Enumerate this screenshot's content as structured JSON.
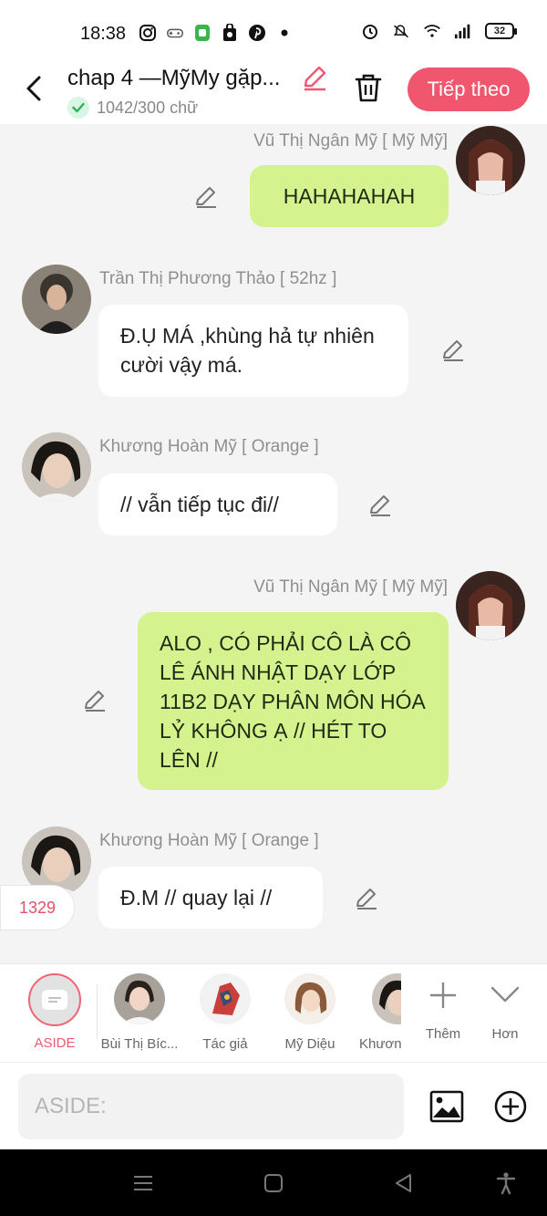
{
  "status": {
    "time": "18:38",
    "battery": "32"
  },
  "header": {
    "title": "chap 4 —MỹMy gặp...",
    "word_count": "1042/300 chữ",
    "next_label": "Tiếp theo"
  },
  "messages": [
    {
      "name": "Vũ Thị Ngân Mỹ [ Mỹ Mỹ]",
      "text": "HAHAHAHAH"
    },
    {
      "name": "Trần Thị Phương Thảo [ 52hz ]",
      "text": "Đ.Ụ MÁ ,khùng hả tự nhiên cười vậy má."
    },
    {
      "name": "Khương Hoàn Mỹ [ Orange ]",
      "text": "// vẫn tiếp tục đi//"
    },
    {
      "name": "Vũ Thị Ngân Mỹ [ Mỹ Mỹ]",
      "text": "ALO , CÓ PHẢI CÔ LÀ CÔ LÊ ÁNH NHẬT DẠY LỚP 11B2 DẠY PHÂN MÔN HÓA LỶ KHÔNG Ạ // HÉT TO LÊN //"
    },
    {
      "name": "Khương Hoàn Mỹ [ Orange ]",
      "text": "Đ.M // quay lại //"
    }
  ],
  "counter": "1329",
  "characters": [
    {
      "label": "ASIDE"
    },
    {
      "label": "Bùi Thị Bíc..."
    },
    {
      "label": "Tác giả"
    },
    {
      "label": "Mỹ Diệu"
    },
    {
      "label": "Khươn"
    },
    {
      "label": "Thêm"
    },
    {
      "label": "Hơn"
    }
  ],
  "input": {
    "placeholder": "ASIDE:"
  },
  "colors": {
    "accent": "#f0566e",
    "green_bubble": "#d4f28e",
    "background": "#f4f4f4"
  }
}
